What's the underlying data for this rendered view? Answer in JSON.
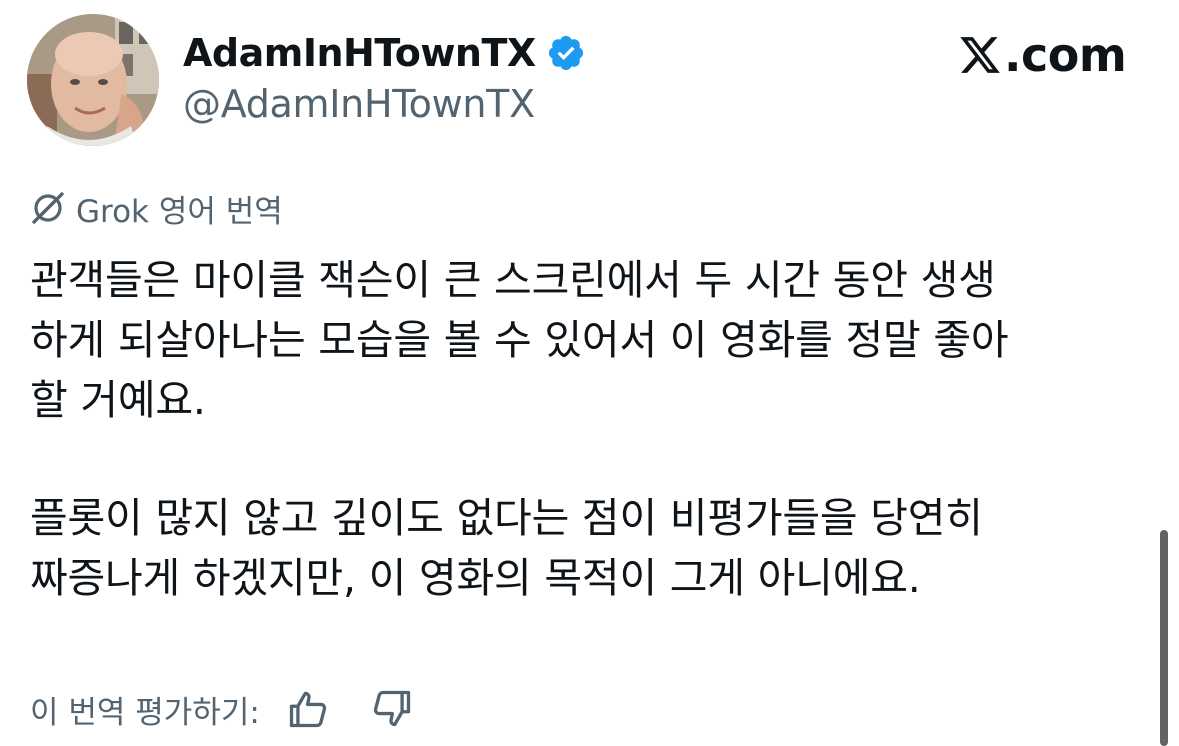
{
  "author": {
    "display_name": "AdamInHTownTX",
    "handle": "@AdamInHTownTX",
    "verified": true,
    "verified_color": "#1d9bf0"
  },
  "site": {
    "domain": ".com",
    "logo_icon": "x-logo-icon"
  },
  "translation": {
    "label": "Grok 영어 번역",
    "icon": "grok-icon"
  },
  "tweet": {
    "lines_para1": [
      "관객들은 마이클 잭슨이 큰 스크린에서 두 시간 동안 생생",
      "하게 되살아나는 모습을 볼 수 있어서 이 영화를 정말 좋아",
      "할 거예요."
    ],
    "lines_para2": [
      "플롯이 많지 않고 깊이도 없다는 점이 비평가들을 당연히",
      "짜증나게 하겠지만, 이 영화의 목적이 그게 아니에요."
    ]
  },
  "rating": {
    "prompt": "이 번역 평가하기:",
    "thumbs_up_icon": "thumbs-up-icon",
    "thumbs_down_icon": "thumbs-down-icon"
  },
  "colors": {
    "text_primary": "#0f1419",
    "text_secondary": "#536471",
    "verified_blue": "#1d9bf0"
  }
}
